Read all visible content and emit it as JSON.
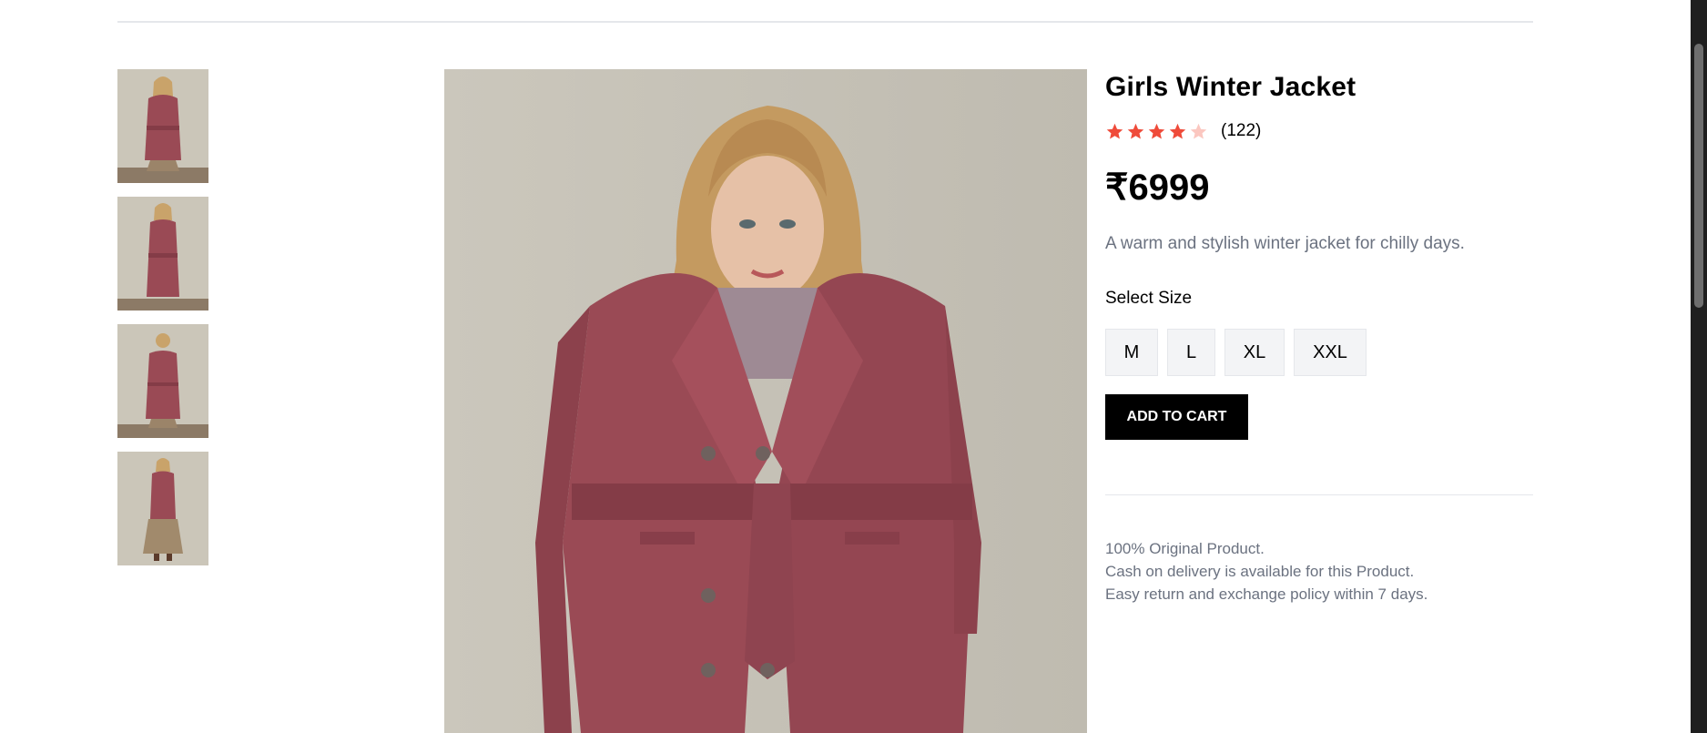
{
  "product": {
    "title": "Girls Winter Jacket",
    "rating": {
      "stars": 4,
      "max": 5,
      "count_text": "(122)"
    },
    "price": "₹6999",
    "description": "A warm and stylish winter jacket for chilly days.",
    "size_label": "Select Size",
    "sizes": [
      "M",
      "L",
      "XL",
      "XXL"
    ],
    "add_to_cart": "ADD TO CART",
    "notes": [
      "100% Original Product.",
      "Cash on delivery is available for this Product.",
      "Easy return and exchange policy within 7 days."
    ]
  },
  "gallery": {
    "thumbnails": [
      "front-view",
      "side-view",
      "back-view",
      "full-length-view"
    ],
    "main_image": "model-in-rose-suede-trench-coat"
  },
  "colors": {
    "accent_star": "#ef4b3a",
    "star_empty": "#fbc7c0",
    "coat": "#9a4a55",
    "button_bg": "#000000"
  }
}
